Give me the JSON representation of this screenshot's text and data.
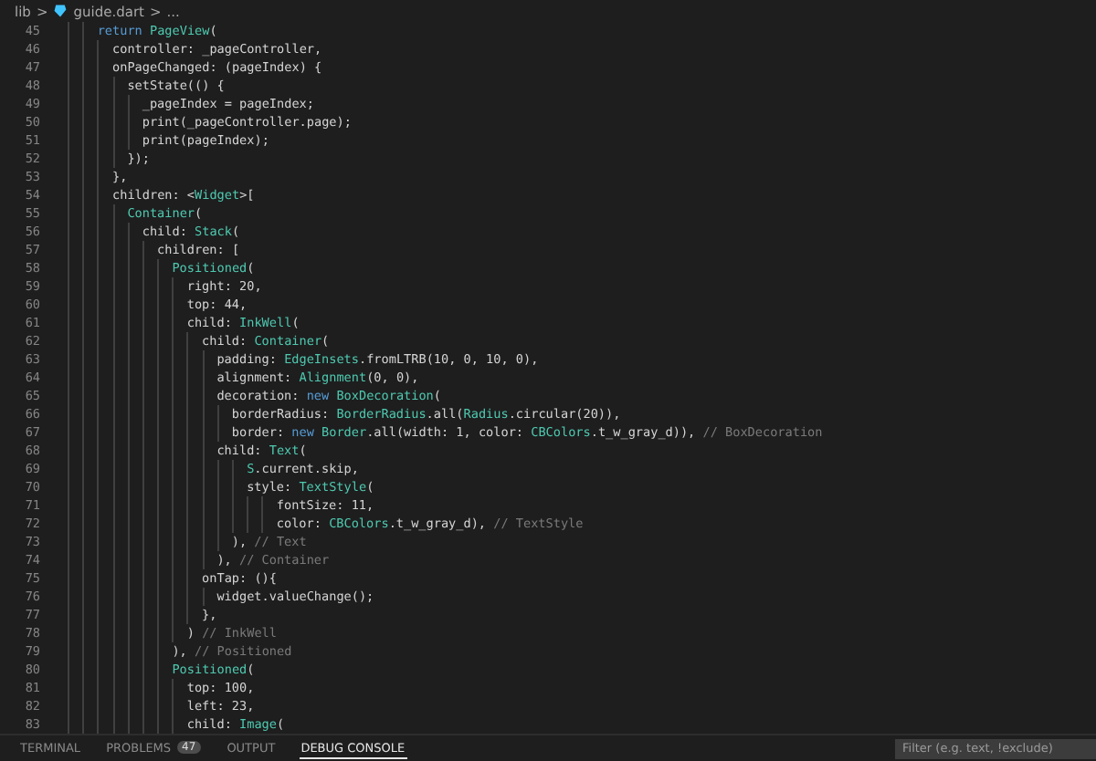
{
  "breadcrumb": {
    "folder": "lib",
    "separators": [
      ">",
      ">"
    ],
    "file": "guide.dart",
    "more": "..."
  },
  "editor": {
    "lines": [
      {
        "number": "45",
        "code": [
          {
            "text": "    return ",
            "kind": "keyword"
          },
          {
            "text": "PageView",
            "kind": "type"
          },
          {
            "text": "(",
            "kind": "plain"
          }
        ]
      },
      {
        "number": "46",
        "code": [
          {
            "text": "      controller: _pageController,",
            "kind": "plain"
          }
        ]
      },
      {
        "number": "47",
        "code": [
          {
            "text": "      onPageChanged: (pageIndex) {",
            "kind": "plain"
          }
        ]
      },
      {
        "number": "48",
        "code": [
          {
            "text": "        setState(() {",
            "kind": "plain"
          }
        ]
      },
      {
        "number": "49",
        "code": [
          {
            "text": "          _pageIndex = pageIndex;",
            "kind": "plain"
          }
        ]
      },
      {
        "number": "50",
        "code": [
          {
            "text": "          print(_pageController.page);",
            "kind": "plain"
          }
        ]
      },
      {
        "number": "51",
        "code": [
          {
            "text": "          print(pageIndex);",
            "kind": "plain"
          }
        ]
      },
      {
        "number": "52",
        "code": [
          {
            "text": "        });",
            "kind": "plain"
          }
        ]
      },
      {
        "number": "53",
        "code": [
          {
            "text": "      },",
            "kind": "plain"
          }
        ]
      },
      {
        "number": "54",
        "code": [
          {
            "text": "      children: <",
            "kind": "plain"
          },
          {
            "text": "Widget",
            "kind": "type"
          },
          {
            "text": ">[",
            "kind": "plain"
          }
        ]
      },
      {
        "number": "55",
        "code": [
          {
            "text": "        Container",
            "kind": "type"
          },
          {
            "text": "(",
            "kind": "plain"
          }
        ]
      },
      {
        "number": "56",
        "code": [
          {
            "text": "          child: ",
            "kind": "plain"
          },
          {
            "text": "Stack",
            "kind": "type"
          },
          {
            "text": "(",
            "kind": "plain"
          }
        ]
      },
      {
        "number": "57",
        "code": [
          {
            "text": "            children: [",
            "kind": "plain"
          }
        ]
      },
      {
        "number": "58",
        "code": [
          {
            "text": "              Positioned",
            "kind": "type"
          },
          {
            "text": "(",
            "kind": "plain"
          }
        ]
      },
      {
        "number": "59",
        "code": [
          {
            "text": "                right: 20,",
            "kind": "plain"
          }
        ]
      },
      {
        "number": "60",
        "code": [
          {
            "text": "                top: 44,",
            "kind": "plain"
          }
        ]
      },
      {
        "number": "61",
        "code": [
          {
            "text": "                child: ",
            "kind": "plain"
          },
          {
            "text": "InkWell",
            "kind": "type"
          },
          {
            "text": "(",
            "kind": "plain"
          }
        ]
      },
      {
        "number": "62",
        "code": [
          {
            "text": "                  child: ",
            "kind": "plain"
          },
          {
            "text": "Container",
            "kind": "type"
          },
          {
            "text": "(",
            "kind": "plain"
          }
        ]
      },
      {
        "number": "63",
        "code": [
          {
            "text": "                    padding: ",
            "kind": "plain"
          },
          {
            "text": "EdgeInsets",
            "kind": "type"
          },
          {
            "text": ".fromLTRB(10, 0, 10, 0),",
            "kind": "plain"
          }
        ]
      },
      {
        "number": "64",
        "code": [
          {
            "text": "                    alignment: ",
            "kind": "plain"
          },
          {
            "text": "Alignment",
            "kind": "type"
          },
          {
            "text": "(0, 0),",
            "kind": "plain"
          }
        ]
      },
      {
        "number": "65",
        "code": [
          {
            "text": "                    decoration: ",
            "kind": "plain"
          },
          {
            "text": "new ",
            "kind": "keyword"
          },
          {
            "text": "BoxDecoration",
            "kind": "type"
          },
          {
            "text": "(",
            "kind": "plain"
          }
        ]
      },
      {
        "number": "66",
        "code": [
          {
            "text": "                      borderRadius: ",
            "kind": "plain"
          },
          {
            "text": "BorderRadius",
            "kind": "type"
          },
          {
            "text": ".all(",
            "kind": "plain"
          },
          {
            "text": "Radius",
            "kind": "type"
          },
          {
            "text": ".circular(20)),",
            "kind": "plain"
          }
        ]
      },
      {
        "number": "67",
        "code": [
          {
            "text": "                      border: ",
            "kind": "plain"
          },
          {
            "text": "new ",
            "kind": "keyword"
          },
          {
            "text": "Border",
            "kind": "type"
          },
          {
            "text": ".all(width: 1, color: ",
            "kind": "plain"
          },
          {
            "text": "CBColors",
            "kind": "type"
          },
          {
            "text": ".t_w_gray_d)), ",
            "kind": "plain"
          },
          {
            "text": "// BoxDecoration",
            "kind": "comment"
          }
        ]
      },
      {
        "number": "68",
        "code": [
          {
            "text": "                    child: ",
            "kind": "plain"
          },
          {
            "text": "Text",
            "kind": "type"
          },
          {
            "text": "(",
            "kind": "plain"
          }
        ]
      },
      {
        "number": "69",
        "code": [
          {
            "text": "                        S",
            "kind": "type"
          },
          {
            "text": ".current.skip,",
            "kind": "plain"
          }
        ]
      },
      {
        "number": "70",
        "code": [
          {
            "text": "                        style: ",
            "kind": "plain"
          },
          {
            "text": "TextStyle",
            "kind": "type"
          },
          {
            "text": "(",
            "kind": "plain"
          }
        ]
      },
      {
        "number": "71",
        "code": [
          {
            "text": "                            fontSize: 11,",
            "kind": "plain"
          }
        ]
      },
      {
        "number": "72",
        "code": [
          {
            "text": "                            color: ",
            "kind": "plain"
          },
          {
            "text": "CBColors",
            "kind": "type"
          },
          {
            "text": ".t_w_gray_d), ",
            "kind": "plain"
          },
          {
            "text": "// TextStyle",
            "kind": "comment"
          }
        ]
      },
      {
        "number": "73",
        "code": [
          {
            "text": "                      ), ",
            "kind": "plain"
          },
          {
            "text": "// Text",
            "kind": "comment"
          }
        ]
      },
      {
        "number": "74",
        "code": [
          {
            "text": "                    ), ",
            "kind": "plain"
          },
          {
            "text": "// Container",
            "kind": "comment"
          }
        ]
      },
      {
        "number": "75",
        "code": [
          {
            "text": "                  onTap: (){",
            "kind": "plain"
          }
        ]
      },
      {
        "number": "76",
        "code": [
          {
            "text": "                    widget.valueChange();",
            "kind": "plain"
          }
        ]
      },
      {
        "number": "77",
        "code": [
          {
            "text": "                  },",
            "kind": "plain"
          }
        ]
      },
      {
        "number": "78",
        "code": [
          {
            "text": "                ) ",
            "kind": "plain"
          },
          {
            "text": "// InkWell",
            "kind": "comment"
          }
        ]
      },
      {
        "number": "79",
        "code": [
          {
            "text": "              ), ",
            "kind": "plain"
          },
          {
            "text": "// Positioned",
            "kind": "comment"
          }
        ]
      },
      {
        "number": "80",
        "code": [
          {
            "text": "              Positioned",
            "kind": "type"
          },
          {
            "text": "(",
            "kind": "plain"
          }
        ]
      },
      {
        "number": "81",
        "code": [
          {
            "text": "                top: 100,",
            "kind": "plain"
          }
        ]
      },
      {
        "number": "82",
        "code": [
          {
            "text": "                left: 23,",
            "kind": "plain"
          }
        ]
      },
      {
        "number": "83",
        "code": [
          {
            "text": "                child: ",
            "kind": "plain"
          },
          {
            "text": "Image",
            "kind": "type"
          },
          {
            "text": "(",
            "kind": "plain"
          }
        ]
      }
    ]
  },
  "panel": {
    "tabs": [
      {
        "label": "TERMINAL",
        "selected": false
      },
      {
        "label": "PROBLEMS",
        "selected": false,
        "badge": "47"
      },
      {
        "label": "OUTPUT",
        "selected": false
      },
      {
        "label": "DEBUG CONSOLE",
        "selected": true
      }
    ],
    "filter": {
      "placeholder": "Filter (e.g. text, !exclude)"
    }
  }
}
